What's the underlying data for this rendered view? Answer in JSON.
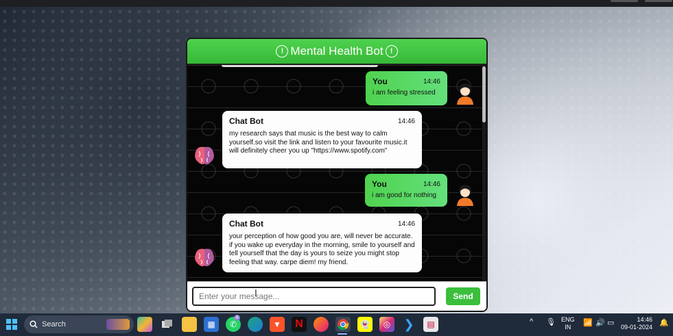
{
  "chat": {
    "title": "Mental Health Bot",
    "header_icon": "warning-circle-icon",
    "messages": [
      {
        "sender": "You",
        "time": "14:46",
        "text": "i am feeling stressed",
        "type": "user"
      },
      {
        "sender": "Chat Bot",
        "time": "14:46",
        "text": "my research says that music is the best way to calm yourself.so visit the link and listen to your favourite music.it will definitely cheer you up \"https://www.spotify.com\"",
        "type": "bot"
      },
      {
        "sender": "You",
        "time": "14:46",
        "text": "i am good for nothing",
        "type": "user"
      },
      {
        "sender": "Chat Bot",
        "time": "14:46",
        "text": "your perception of how good you are, will never be accurate. if you wake up everyday in the morning, smile to yourself and tell yourself that the day is yours to seize you might stop feeling that way. carpe diem! my friend.",
        "type": "bot"
      }
    ],
    "input": {
      "placeholder": "Enter your message...",
      "value": ""
    },
    "send_label": "Send",
    "colors": {
      "header": "#3fc43f",
      "user_bubble": "#5cdc6a",
      "bot_bubble": "#fdfdfd",
      "body": "#060606"
    }
  },
  "taskbar": {
    "search_label": "Search",
    "apps": [
      "windows-start-icon",
      "copilot-icon",
      "task-view-icon",
      "file-explorer-icon",
      "microsoft-store-icon",
      "whatsapp-icon",
      "edge-icon",
      "brave-icon",
      "netflix-icon",
      "firefox-icon",
      "chrome-icon",
      "snapchat-icon",
      "instagram-icon",
      "vscode-icon",
      "notepad-icon"
    ],
    "whatsapp_badge": "4",
    "language": [
      "ENG",
      "IN"
    ],
    "time": "14:46",
    "date": "09-01-2024"
  }
}
